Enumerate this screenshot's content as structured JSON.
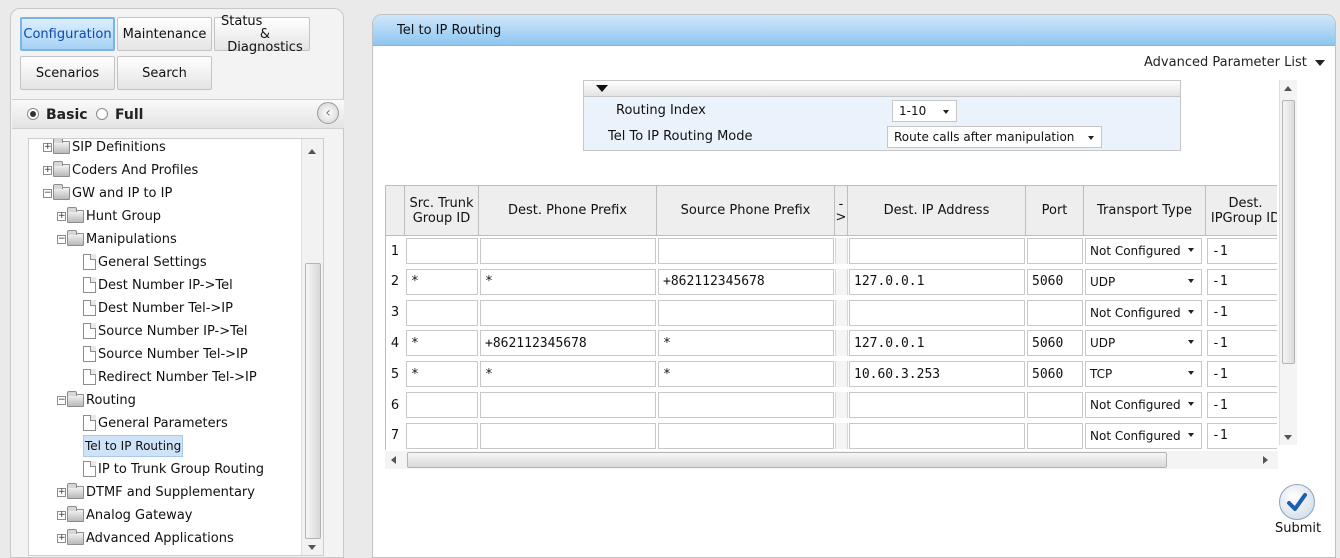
{
  "menu": {
    "configuration": "Configuration",
    "maintenance": "Maintenance",
    "status_line1": "Status",
    "status_line2": "& Diagnostics",
    "scenarios": "Scenarios",
    "search": "Search"
  },
  "mode": {
    "basic": "Basic",
    "full": "Full",
    "selected": "Basic"
  },
  "tree": [
    {
      "label": "SIP Definitions",
      "kind": "folder",
      "state": "collapsed"
    },
    {
      "label": "Coders And Profiles",
      "kind": "folder",
      "state": "collapsed"
    },
    {
      "label": "GW and IP to IP",
      "kind": "folder",
      "state": "expanded"
    },
    {
      "label": "Hunt Group",
      "kind": "folder",
      "state": "collapsed"
    },
    {
      "label": "Manipulations",
      "kind": "folder",
      "state": "expanded"
    },
    {
      "label": "General Settings",
      "kind": "page"
    },
    {
      "label": "Dest Number IP->Tel",
      "kind": "page"
    },
    {
      "label": "Dest Number Tel->IP",
      "kind": "page"
    },
    {
      "label": "Source Number IP->Tel",
      "kind": "page"
    },
    {
      "label": "Source Number Tel->IP",
      "kind": "page"
    },
    {
      "label": "Redirect Number Tel->IP",
      "kind": "page"
    },
    {
      "label": "Routing",
      "kind": "folder",
      "state": "expanded"
    },
    {
      "label": "General Parameters",
      "kind": "page"
    },
    {
      "label": "Tel to IP Routing",
      "kind": "page",
      "selected": true
    },
    {
      "label": "IP to Trunk Group Routing",
      "kind": "page"
    },
    {
      "label": "DTMF and Supplementary",
      "kind": "folder",
      "state": "collapsed"
    },
    {
      "label": "Analog Gateway",
      "kind": "folder",
      "state": "collapsed"
    },
    {
      "label": "Advanced Applications",
      "kind": "folder",
      "state": "collapsed"
    }
  ],
  "page": {
    "title": "Tel to IP Routing",
    "advanced_list": "Advanced Parameter List",
    "routing_index_label": "Routing Index",
    "routing_index_value": "1-10",
    "routing_mode_label": "Tel To IP Routing Mode",
    "routing_mode_value": "Route calls after manipulation",
    "submit": "Submit"
  },
  "table": {
    "headers": {
      "src_trunk_line1": "Src. Trunk",
      "src_trunk_line2": "Group ID",
      "dest_prefix": "Dest. Phone Prefix",
      "src_prefix": "Source Phone Prefix",
      "arrow_line1": "-",
      "arrow_line2": ">",
      "dest_ip": "Dest. IP Address",
      "port": "Port",
      "transport": "Transport Type",
      "dest_ipgroup_line1": "Dest.",
      "dest_ipgroup_line2": "IPGroup ID"
    },
    "rows": [
      {
        "n": "1",
        "src": "",
        "dest": "",
        "source": "",
        "ip": "",
        "port": "",
        "transport": "Not Configured",
        "group": "-1"
      },
      {
        "n": "2",
        "src": "*",
        "dest": "*",
        "source": "+862112345678",
        "ip": "127.0.0.1",
        "port": "5060",
        "transport": "UDP",
        "group": "-1"
      },
      {
        "n": "3",
        "src": "",
        "dest": "",
        "source": "",
        "ip": "",
        "port": "",
        "transport": "Not Configured",
        "group": "-1"
      },
      {
        "n": "4",
        "src": "*",
        "dest": "+862112345678",
        "source": "*",
        "ip": "127.0.0.1",
        "port": "5060",
        "transport": "UDP",
        "group": "-1"
      },
      {
        "n": "5",
        "src": "*",
        "dest": "*",
        "source": "*",
        "ip": "10.60.3.253",
        "port": "5060",
        "transport": "TCP",
        "group": "-1"
      },
      {
        "n": "6",
        "src": "",
        "dest": "",
        "source": "",
        "ip": "",
        "port": "",
        "transport": "Not Configured",
        "group": "-1"
      },
      {
        "n": "7",
        "src": "",
        "dest": "",
        "source": "",
        "ip": "",
        "port": "",
        "transport": "Not Configured",
        "group": "-1"
      }
    ]
  }
}
